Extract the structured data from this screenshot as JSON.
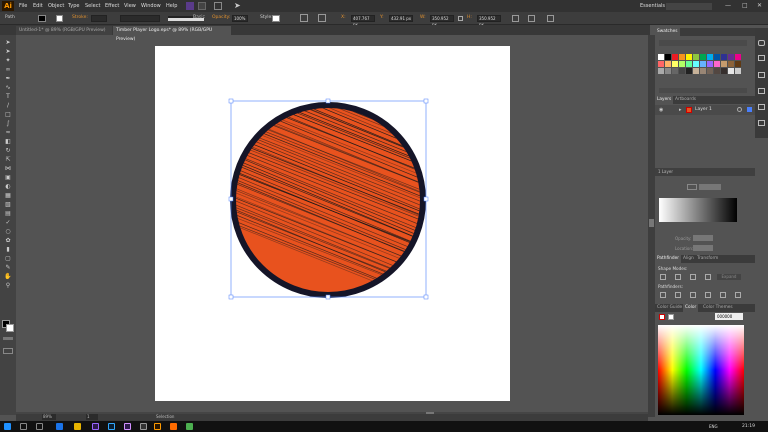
{
  "app": {
    "logo": "Ai"
  },
  "menu": [
    "File",
    "Edit",
    "Object",
    "Type",
    "Select",
    "Effect",
    "View",
    "Window",
    "Help"
  ],
  "workspace": "Essentials",
  "control_bar": {
    "selection_label": "Path",
    "stroke_label": "Stroke:",
    "brush_label": "Basic",
    "opacity_label": "Opacity:",
    "opacity_value": "100%",
    "style_label": "Style:",
    "x_value": "407.767 px",
    "y_value": "432.91 px",
    "w_value": "350.952 px",
    "h_value": "350.952 px"
  },
  "doc_tabs": [
    {
      "label": "Untitled-1* @ 89% (RGB/GPU Preview)",
      "active": false
    },
    {
      "label": "Timber Player Logo.eps* @ 89% (RGB/GPU Preview)",
      "active": true
    }
  ],
  "swatches_panel": {
    "title": "Swatches"
  },
  "layers_panel": {
    "tabs": [
      "Layers",
      "Artboards"
    ],
    "layer_name": "Layer 1",
    "footer": "1 Layer"
  },
  "pathfinder_panel": {
    "tabs": [
      "Pathfinder",
      "Align",
      "Transform"
    ],
    "shape_modes": "Shape Modes:",
    "expand": "Expand",
    "pathfinders": "Pathfinders:"
  },
  "gradient_panel": {
    "opacity_label": "Opacity:",
    "location_label": "Location:"
  },
  "color_panel": {
    "tabs": [
      "Color Guide",
      "Color",
      "Color Themes"
    ],
    "hex": "000000"
  },
  "status_bar": {
    "zoom": "89%",
    "page": "1",
    "tool": "Selection"
  },
  "taskbar": {
    "lang": "ENG",
    "time": "21:19"
  },
  "colors": {
    "fill": "#e8521e",
    "stroke": "#151528",
    "accent": "#ff9a00"
  }
}
